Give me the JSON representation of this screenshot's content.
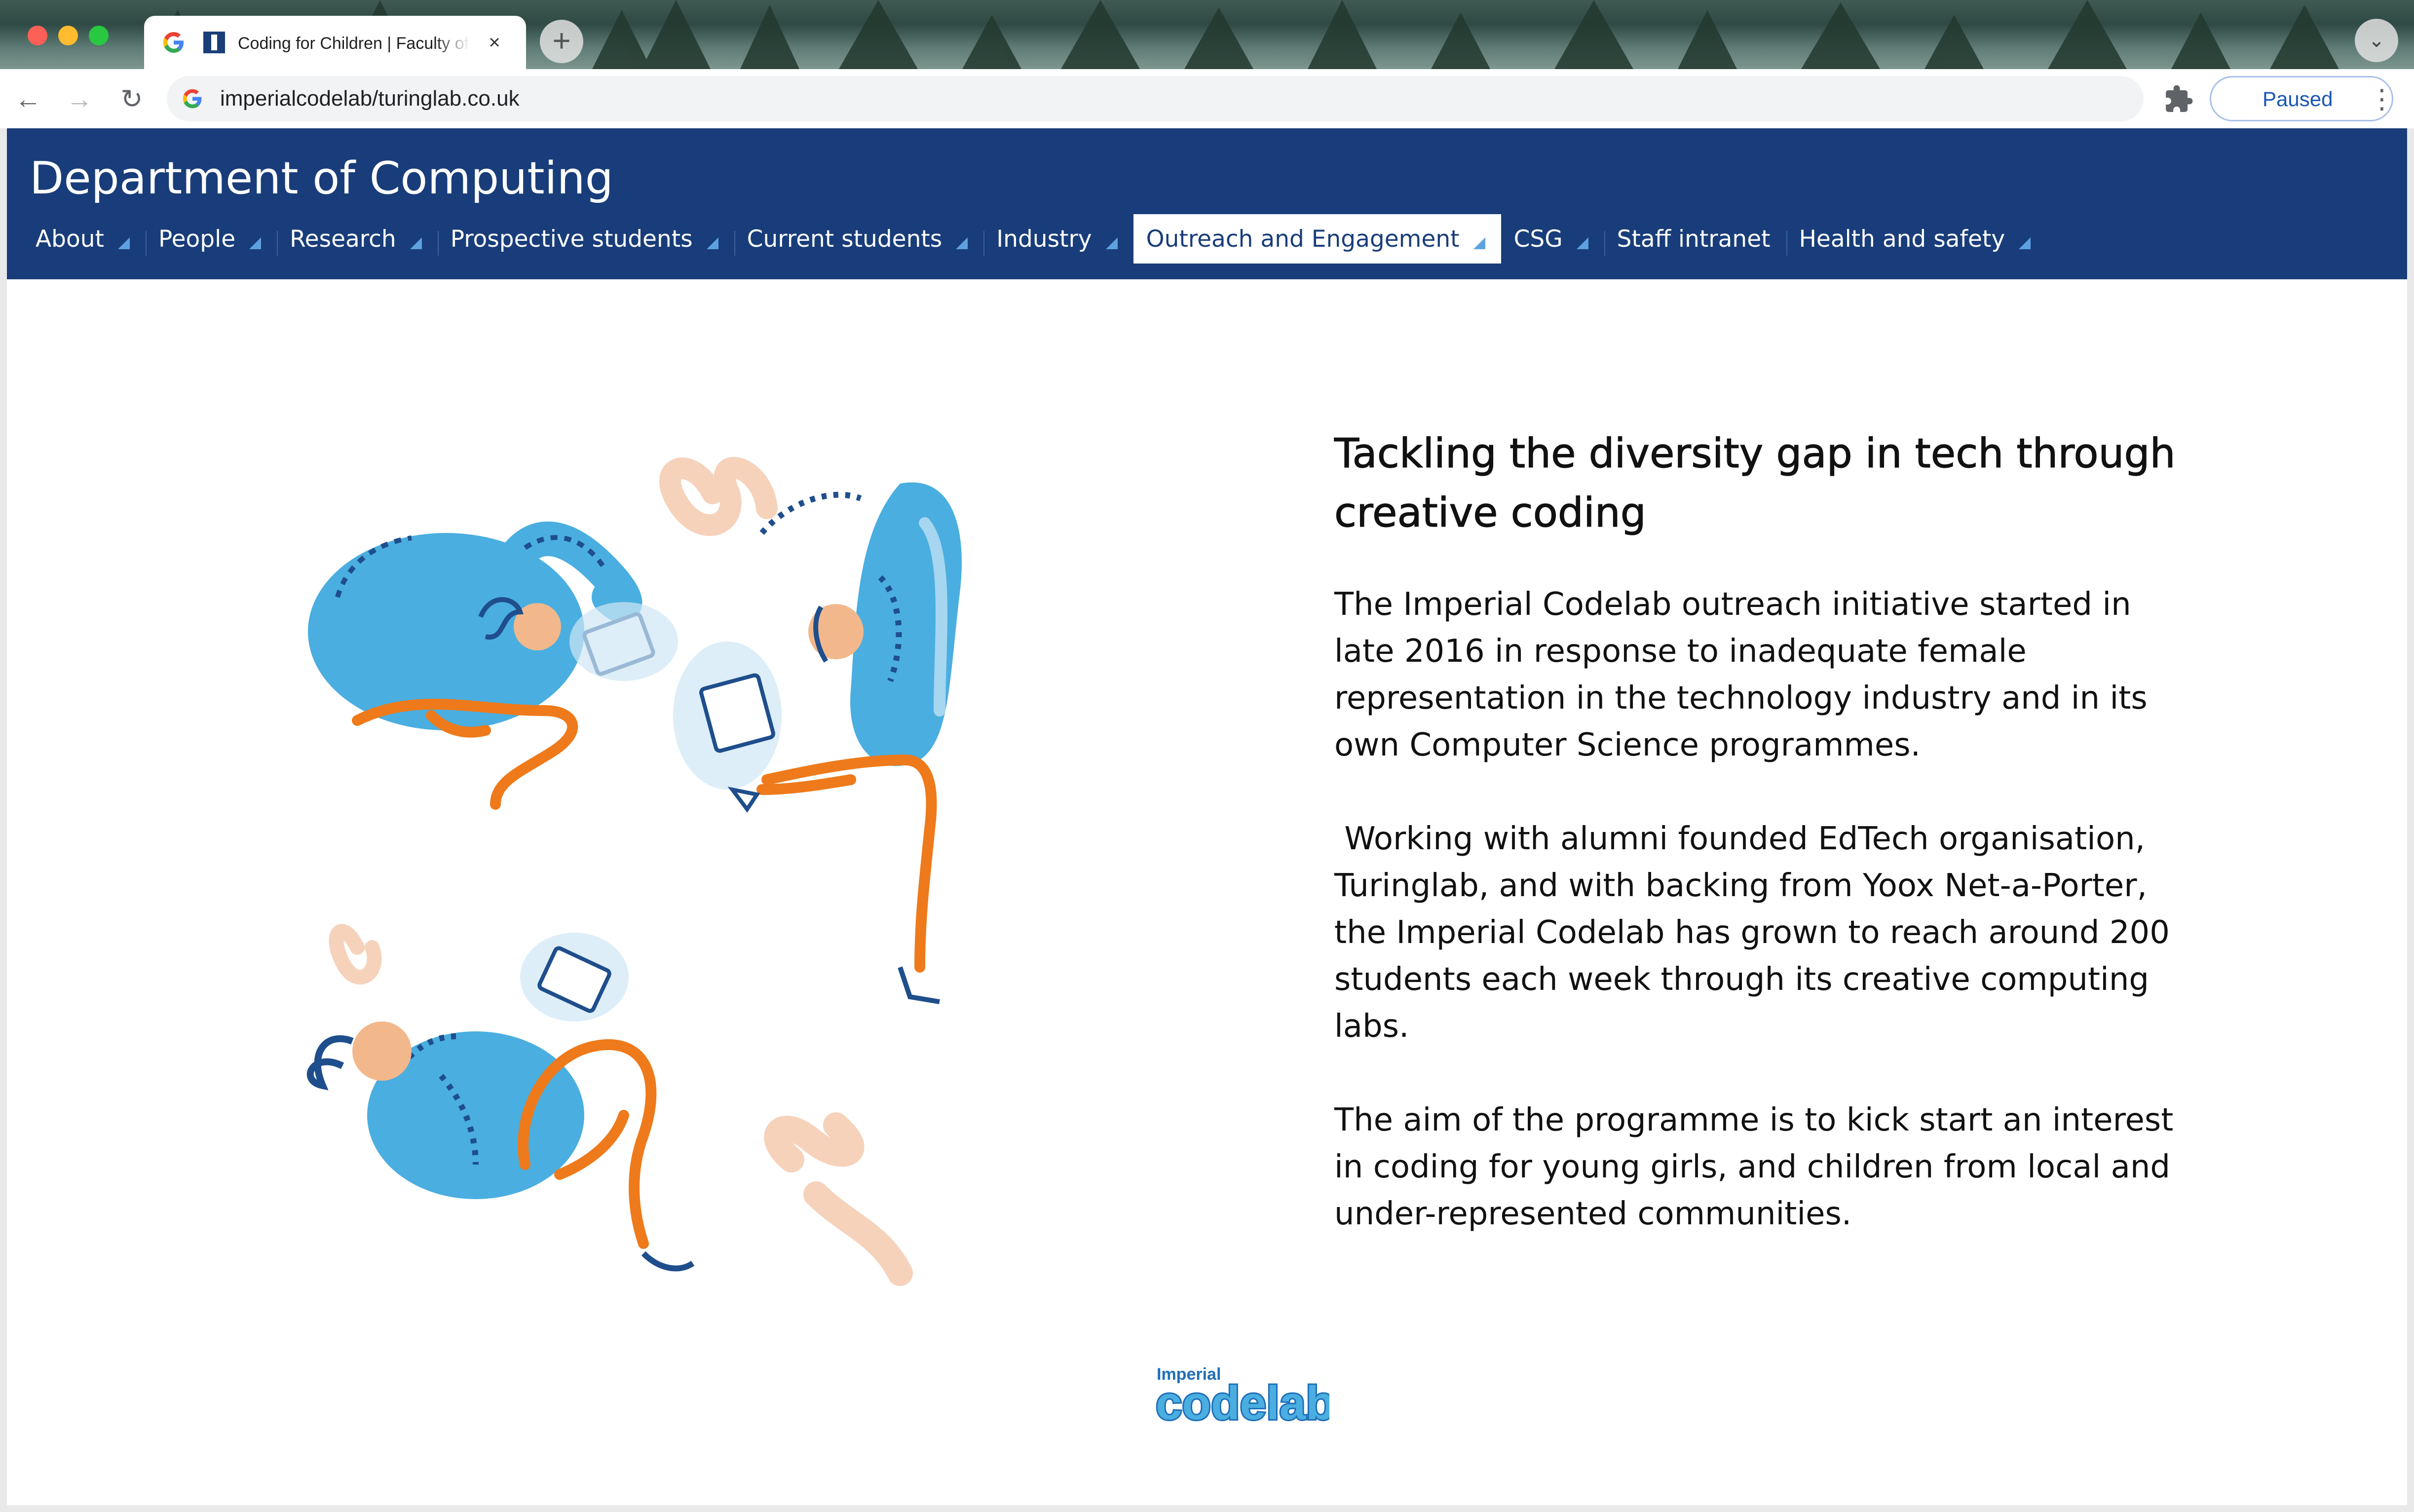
{
  "browser": {
    "tab_title": "Coding for Children | Faculty of Engineering",
    "tab_close": "×",
    "new_tab": "+",
    "tab_search": "⌄",
    "url": "imperialcodelab/turinglab.co.uk",
    "profile_status": "Paused",
    "nav_back": "←",
    "nav_forward": "→",
    "nav_reload": "↻",
    "menu": "⋮"
  },
  "site": {
    "title": "Department of Computing",
    "nav": [
      {
        "label": "About",
        "has_dropdown": true
      },
      {
        "label": "People",
        "has_dropdown": true
      },
      {
        "label": "Research",
        "has_dropdown": true
      },
      {
        "label": "Prospective students",
        "has_dropdown": true
      },
      {
        "label": "Current students",
        "has_dropdown": true
      },
      {
        "label": "Industry",
        "has_dropdown": true
      },
      {
        "label": "Outreach and Engagement",
        "has_dropdown": true,
        "active": true
      },
      {
        "label": "CSG",
        "has_dropdown": true
      },
      {
        "label": "Staff intranet",
        "has_dropdown": false
      },
      {
        "label": "Health and safety",
        "has_dropdown": true
      }
    ],
    "colors": {
      "header": "#193d7a",
      "caret": "#5da2df",
      "figure_blue": "#4aaee0",
      "figure_orange": "#ee7a1b"
    }
  },
  "article": {
    "heading": "Tackling the diversity gap in tech through creative coding",
    "paragraphs": [
      "The Imperial Codelab outreach initiative started in late 2016 in response to inadequate female representation in the technology industry and in its own Computer Science programmes.",
      " Working with alumni founded EdTech organisation, Turinglab, and with backing from Yoox Net-a-Porter, the Imperial Codelab has grown to reach around 200 students each week through its creative computing labs.",
      "The aim of the programme is to kick start an interest in coding for young girls, and children from local and under-represented communities."
    ]
  },
  "logo": {
    "small": "Imperial",
    "main": "codelab"
  }
}
